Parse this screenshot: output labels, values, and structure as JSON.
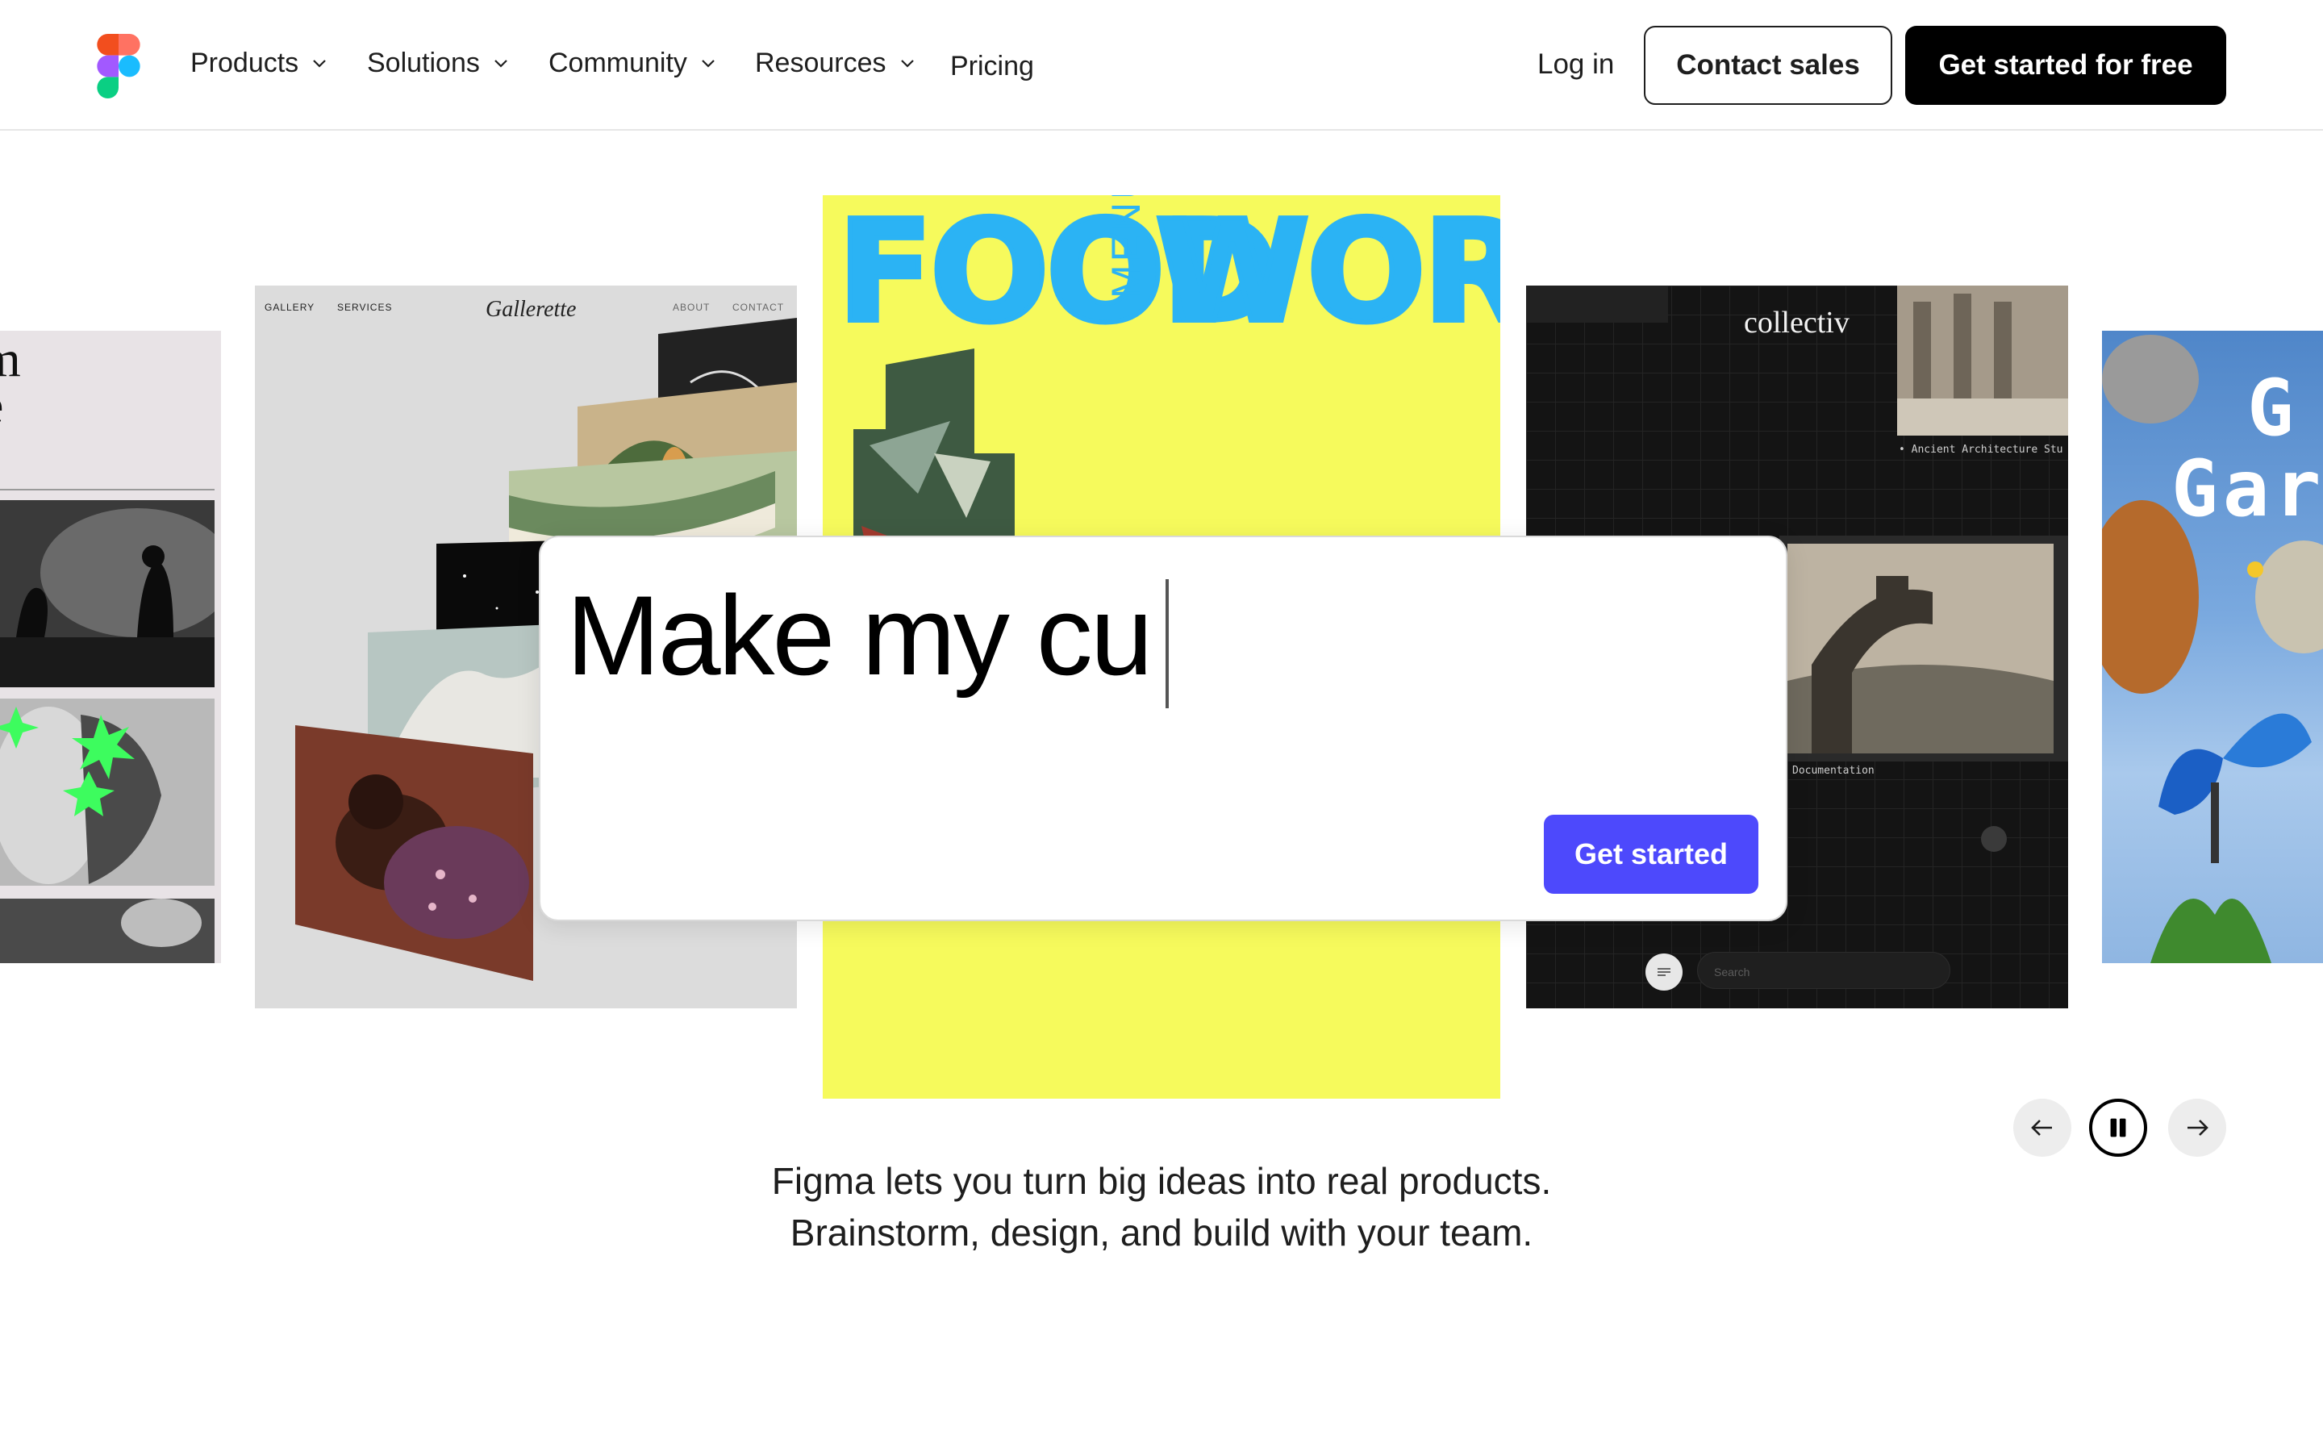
{
  "nav": {
    "items": [
      {
        "label": "Products",
        "dropdown": true
      },
      {
        "label": "Solutions",
        "dropdown": true
      },
      {
        "label": "Community",
        "dropdown": true
      },
      {
        "label": "Resources",
        "dropdown": true
      },
      {
        "label": "Pricing",
        "dropdown": false
      }
    ],
    "login_label": "Log in",
    "contact_label": "Contact sales",
    "cta_label": "Get started for free"
  },
  "carousel": {
    "gallerette": {
      "nav_left": [
        "GALLERY",
        "SERVICES"
      ],
      "logo": "Gallerette",
      "nav_right": [
        "ABOUT",
        "CONTACT"
      ]
    },
    "food": {
      "word1": "FOOD",
      "menu": "MENU",
      "word2": "WORKS"
    },
    "collectiv": {
      "logo": "collectiv",
      "caption_top": "• Ancient Architecture Stu",
      "caption_doc": "Documentation",
      "search_placeholder": "Search"
    },
    "partial_left": {
      "line1": "m",
      "line2": "e"
    },
    "partial_right": {
      "line1": "G",
      "line2": "Gar"
    }
  },
  "prompt": {
    "typed_text": "Make my cu",
    "submit_label": "Get started"
  },
  "controls": {
    "prev_icon": "arrow-left-icon",
    "pause_icon": "pause-icon",
    "next_icon": "arrow-right-icon"
  },
  "tagline": {
    "line1": "Figma lets you turn big ideas into real products.",
    "line2": "Brainstorm, design, and build with your team."
  },
  "colors": {
    "brand_purple": "#4d49fc",
    "food_yellow": "#f6fa5c",
    "food_blue": "#2bb3f4",
    "collectiv_bg": "#141414"
  }
}
